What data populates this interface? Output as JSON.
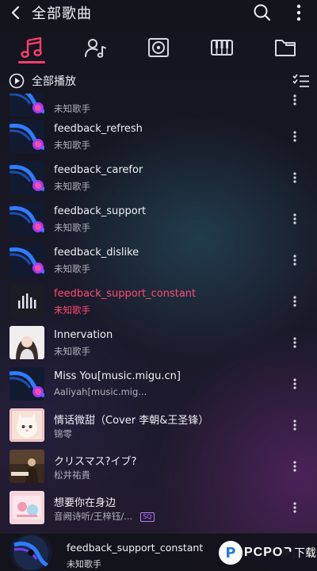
{
  "header": {
    "title": "全部歌曲",
    "icons": [
      "back-arrow-icon",
      "search-icon",
      "more-vertical-icon"
    ]
  },
  "tabs": [
    {
      "name": "songs",
      "icon": "music-note-icon",
      "active": true
    },
    {
      "name": "artists",
      "icon": "singer-icon",
      "active": false
    },
    {
      "name": "albums",
      "icon": "album-icon",
      "active": false
    },
    {
      "name": "genres",
      "icon": "piano-icon",
      "active": false
    },
    {
      "name": "folders",
      "icon": "folder-icon",
      "active": false
    }
  ],
  "playall": {
    "label": "全部播放",
    "icons": [
      "play-circle-icon",
      "multi-select-list-icon"
    ]
  },
  "songs": [
    {
      "title": "",
      "artist": "未知歌手",
      "cover": "default"
    },
    {
      "title": "feedback_refresh",
      "artist": "未知歌手",
      "cover": "default"
    },
    {
      "title": "feedback_carefor",
      "artist": "未知歌手",
      "cover": "default"
    },
    {
      "title": "feedback_support",
      "artist": "未知歌手",
      "cover": "default"
    },
    {
      "title": "feedback_dislike",
      "artist": "未知歌手",
      "cover": "default"
    },
    {
      "title": "feedback_support_constant",
      "artist": "未知歌手",
      "cover": "playing",
      "active": true
    },
    {
      "title": "Innervation",
      "artist": "未知歌手",
      "cover": "portrait"
    },
    {
      "title": "Miss You[music.migu.cn]",
      "artist": "Aaliyah[music.mig...",
      "cover": "default"
    },
    {
      "title": "情话微甜（Cover 李朝&王圣锋）",
      "artist": "锦零",
      "cover": "cat"
    },
    {
      "title": "クリスマス?イブ?",
      "artist": "松井祐貴",
      "cover": "piano"
    },
    {
      "title": "想要你在身边",
      "artist": "音阙诗听/王梓钰/...",
      "cover": "pink",
      "badge": "SQ"
    }
  ],
  "player": {
    "title": "feedback_support_constant",
    "artist": "未知歌手",
    "watermark": {
      "p": "P",
      "text": "PCPOP",
      "suffix": "下载"
    }
  },
  "colors": {
    "accent": "#ff3d6e",
    "active_text": "#ff4a72",
    "sq_badge": "#b57bff"
  }
}
